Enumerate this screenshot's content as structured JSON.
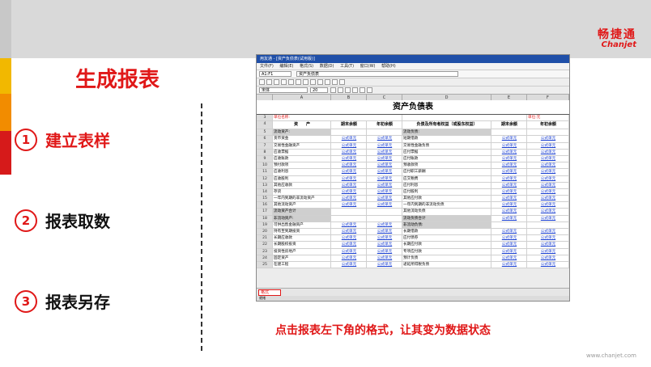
{
  "logo": {
    "cn": "畅捷通",
    "en": "Chanjet"
  },
  "slide_title": "生成报表",
  "steps": [
    {
      "num": "1",
      "label": "建立表样"
    },
    {
      "num": "2",
      "label": "报表取数"
    },
    {
      "num": "3",
      "label": "报表另存"
    }
  ],
  "screenshot": {
    "window_title": "用友通 - [资产负债表(试用版)]",
    "menu": [
      "文件(F)",
      "编辑(E)",
      "格式(S)",
      "数据(D)",
      "工具(T)",
      "窗口(W)",
      "帮助(H)"
    ],
    "cell_ref": "A1:F1",
    "formula_text": "资产负债表",
    "font_name": "宋体",
    "font_size": "20",
    "columns": [
      "A",
      "B",
      "C",
      "D",
      "E",
      "F"
    ],
    "report_title": "资产负债表",
    "unit_label": "单位名称:",
    "currency_label": "单位:元",
    "headers": [
      "资　　产",
      "期末余额",
      "年初余额",
      "负债及所有者权益（或股东权益）",
      "期末余额",
      "年初余额"
    ],
    "formula_cell": "公式单元",
    "left_items": [
      "流动资产:",
      "货币资金",
      "交易性金融资产",
      "应收票据",
      "应收账款",
      "预付款项",
      "应收利息",
      "应收股利",
      "其他应收款",
      "存货",
      "一年内到期的非流动资产",
      "其他流动资产",
      "流动资产合计",
      "非流动资产:",
      "可供出售金融资产",
      "持有至到期投资",
      "长期应收款",
      "长期股权投资",
      "投资性房地产",
      "固定资产",
      "在建工程"
    ],
    "right_items": [
      "流动负债:",
      "短期借款",
      "交易性金融负债",
      "应付票据",
      "应付账款",
      "预收款项",
      "应付职工薪酬",
      "应交税费",
      "应付利息",
      "应付股利",
      "其他应付款",
      "一年内到期的非流动负债",
      "其他流动负债",
      "流动负债合计",
      "非流动负债:",
      "长期借款",
      "应付债券",
      "长期应付款",
      "专项应付款",
      "预计负债",
      "递延所得税负债"
    ],
    "format_tab": "格式",
    "status": "就绪"
  },
  "caption": "点击报表左下角的格式，让其变为数据状态",
  "site": "www.chanjet.com"
}
